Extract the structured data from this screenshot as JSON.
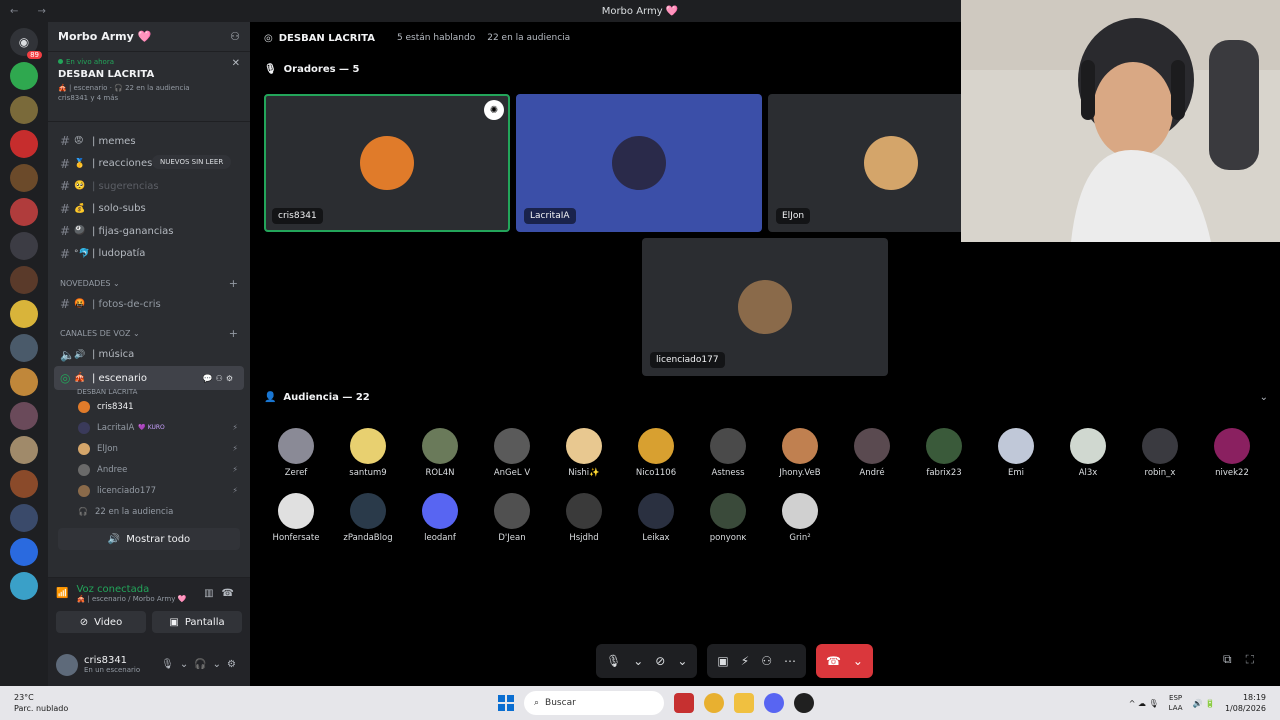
{
  "window": {
    "title": "Morbo Army 🩷",
    "nav": "← →"
  },
  "servers": {
    "dm_badge": "89",
    "items": [
      "#2fa84f",
      "#7a6a3a",
      "#c62d2d",
      "#6b4a2a",
      "#b03c3c",
      "#3c3c44",
      "#5a3a2a",
      "#d9b43a",
      "#4a5a6a",
      "#c0873a",
      "#6a4a5a",
      "#a08a6a",
      "#8a4a2a",
      "#3a4a6a",
      "#2a6adf",
      "#3aa0c8"
    ]
  },
  "sidebar": {
    "server_name": "Morbo Army 🩷",
    "live": {
      "tag": "En vivo ahora",
      "stage_title": "DESBAN LACRITA",
      "meta1": "🎪 | escenario · 🎧 22 en la audiencia",
      "meta2": "cris8341 y 4 más"
    },
    "unread_pill": "NUEVOS SIN LEER",
    "channels_a": [
      {
        "emo": "😡",
        "name": "| memes"
      },
      {
        "emo": "🥇",
        "name": "| reacciones"
      },
      {
        "emo": "🥺",
        "name": "| sugerencias"
      },
      {
        "emo": "💰",
        "name": "| solo-subs"
      },
      {
        "emo": "🎱",
        "name": "| fijas-ganancias"
      },
      {
        "emo": "°🐬",
        "name": "| ludopatía"
      }
    ],
    "cat_novedades": "NOVEDADES",
    "channel_fotos": {
      "emo": "🤬",
      "name": "| fotos-de-cris"
    },
    "cat_voz": "CANALES DE VOZ",
    "channel_musica": {
      "emo": "🔊",
      "name": "| música"
    },
    "channel_escenario": {
      "emo": "🎪",
      "name": "| escenario"
    },
    "escenario_sub": "DESBAN LACRITA",
    "voice_users": [
      {
        "name": "cris8341",
        "color": "#e07b2a"
      },
      {
        "name": "LacritaIA",
        "color": "#3a3a5a",
        "badge": "💜 KURO"
      },
      {
        "name": "ElJon",
        "color": "#d4a56a"
      },
      {
        "name": "Andree",
        "color": "#6a6a6a"
      },
      {
        "name": "licenciado177",
        "color": "#8a6a4a"
      }
    ],
    "audience_note": "22 en la audiencia",
    "show_all": "Mostrar todo"
  },
  "voice_panel": {
    "status": "Voz conectada",
    "sub": "🎪 | escenario / Morbo Army 🩷",
    "video_label": "Video",
    "screen_label": "Pantalla"
  },
  "user_panel": {
    "name": "cris8341",
    "status": "En un escenario"
  },
  "stage": {
    "title": "DESBAN LACRITA",
    "speaking": "5 están hablando",
    "audience_count_text": "22 en la audiencia",
    "speakers_title": "Oradores — 5",
    "audience_title": "Audiencia — 22",
    "speakers": [
      {
        "name": "cris8341",
        "bg": "#2b2d31",
        "pic": "#e07b2a",
        "speaking": true
      },
      {
        "name": "LacritaIA",
        "bg": "#3b4fa8",
        "pic": "#2a2a4a",
        "speaking": false
      },
      {
        "name": "ElJon",
        "bg": "#2b2d31",
        "pic": "#d4a56a",
        "speaking": false
      },
      {
        "name": "licenciado177",
        "bg": "#2b2d31",
        "pic": "#8a6a4a",
        "speaking": false
      }
    ],
    "audience": [
      {
        "name": "Zeref",
        "color": "#8a8a96"
      },
      {
        "name": "santum9",
        "color": "#e8d070"
      },
      {
        "name": "ROL4N",
        "color": "#6a7a5a"
      },
      {
        "name": "AnGeL V",
        "color": "#5a5a5a"
      },
      {
        "name": "Nishi✨",
        "color": "#e8c890"
      },
      {
        "name": "Nico1106",
        "color": "#d8a030"
      },
      {
        "name": "Astness",
        "color": "#4a4a4a"
      },
      {
        "name": "Jhony.VeB",
        "color": "#c08050"
      },
      {
        "name": "André",
        "color": "#5a4a50"
      },
      {
        "name": "fabrix23",
        "color": "#3a5a3a"
      },
      {
        "name": "Emi",
        "color": "#c0c8d8"
      },
      {
        "name": "Al3x",
        "color": "#d0d8d0"
      },
      {
        "name": "robin_x",
        "color": "#3a3a40"
      },
      {
        "name": "nivek22",
        "color": "#8a2060"
      },
      {
        "name": "Honfersate",
        "color": "#e0e0e0"
      },
      {
        "name": "zPandaBlog",
        "color": "#2a3a4a"
      },
      {
        "name": "leodanf",
        "color": "#5865f2"
      },
      {
        "name": "D'Jean",
        "color": "#505050"
      },
      {
        "name": "Hsjdhd",
        "color": "#3a3a3a"
      },
      {
        "name": "Leikax",
        "color": "#2a3040"
      },
      {
        "name": "ponyonĸ",
        "color": "#3a4a3a"
      },
      {
        "name": "Grin²",
        "color": "#d0d0d0"
      }
    ]
  },
  "taskbar": {
    "temp": "23°C",
    "weather": "Parc. nublado",
    "search": "Buscar",
    "lang1": "ESP",
    "lang2": "LAA",
    "time": "18:19",
    "date": "1/08/2026"
  }
}
